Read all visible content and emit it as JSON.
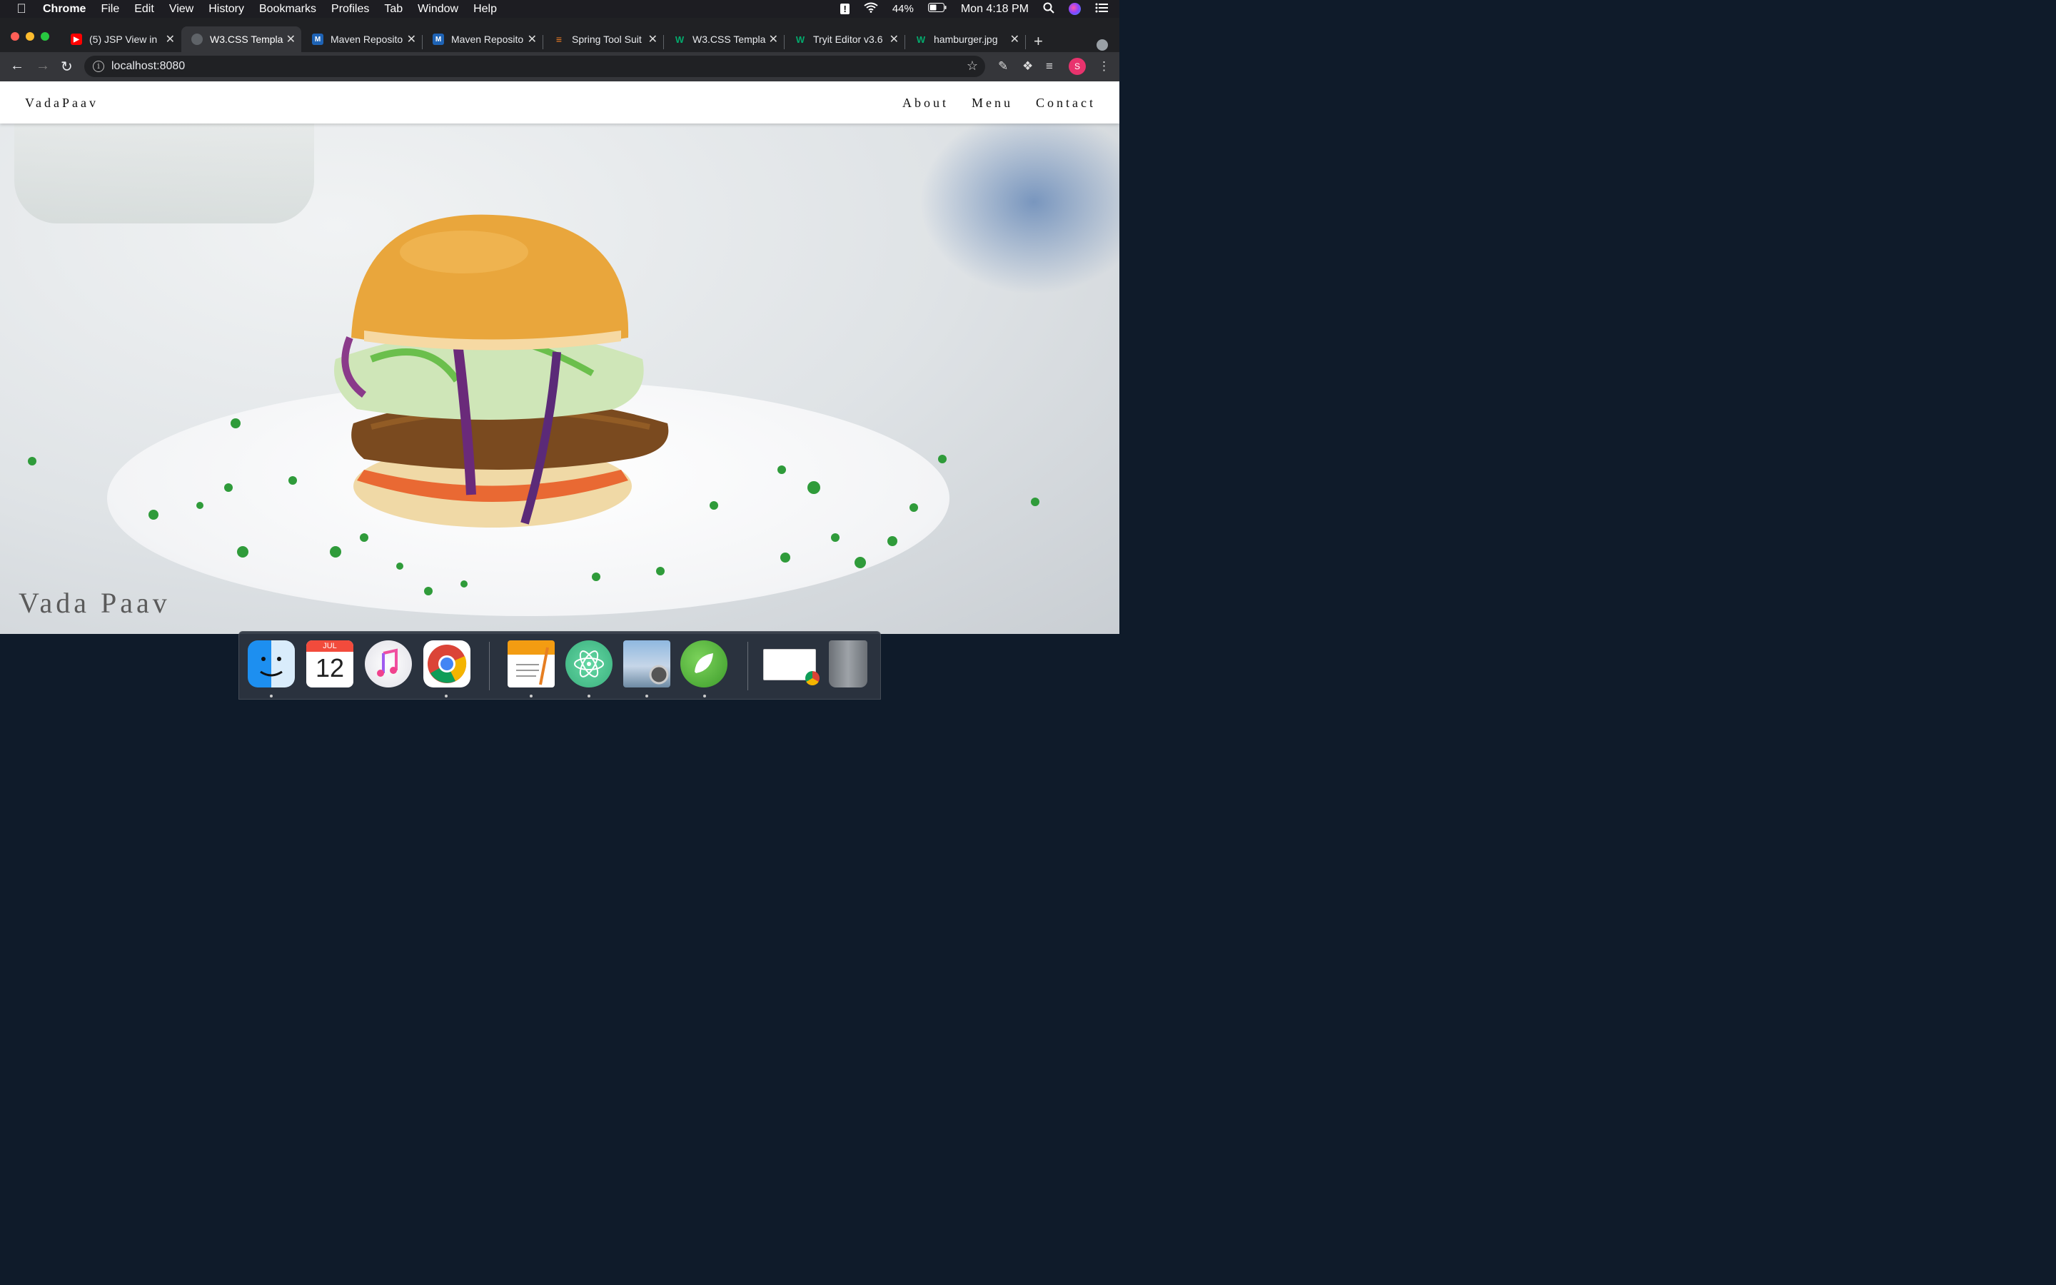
{
  "menubar": {
    "app_name": "Chrome",
    "items": [
      "File",
      "Edit",
      "View",
      "History",
      "Bookmarks",
      "Profiles",
      "Tab",
      "Window",
      "Help"
    ],
    "battery": "44%",
    "clock": "Mon 4:18 PM"
  },
  "tabs": [
    {
      "title": "(5) JSP View in",
      "favicon": "youtube-icon"
    },
    {
      "title": "W3.CSS Templa",
      "favicon": "globe-icon",
      "active": true
    },
    {
      "title": "Maven Reposito",
      "favicon": "mvn-icon"
    },
    {
      "title": "Maven Reposito",
      "favicon": "mvn-icon"
    },
    {
      "title": "Spring Tool Suit",
      "favicon": "stackoverflow-icon"
    },
    {
      "title": "W3.CSS Templa",
      "favicon": "w3schools-icon"
    },
    {
      "title": "Tryit Editor v3.6",
      "favicon": "w3schools-icon"
    },
    {
      "title": "hamburger.jpg",
      "favicon": "w3schools-icon"
    }
  ],
  "toolbar": {
    "url": "localhost:8080",
    "avatar_letter": "S"
  },
  "site": {
    "brand": "VadaPaav",
    "nav": [
      "About",
      "Menu",
      "Contact"
    ],
    "hero_caption": "Vada Paav"
  },
  "dock": {
    "calendar_month": "JUL",
    "calendar_day": "12",
    "apps": [
      "finder-icon",
      "calendar-icon",
      "music-icon",
      "chrome-icon",
      "pages-icon",
      "atom-icon",
      "preview-icon",
      "spring-icon",
      "window-thumbnail-icon",
      "trash-icon"
    ]
  },
  "colors": {
    "accent_avatar": "#e8336d",
    "chrome_dark": "#202124"
  }
}
